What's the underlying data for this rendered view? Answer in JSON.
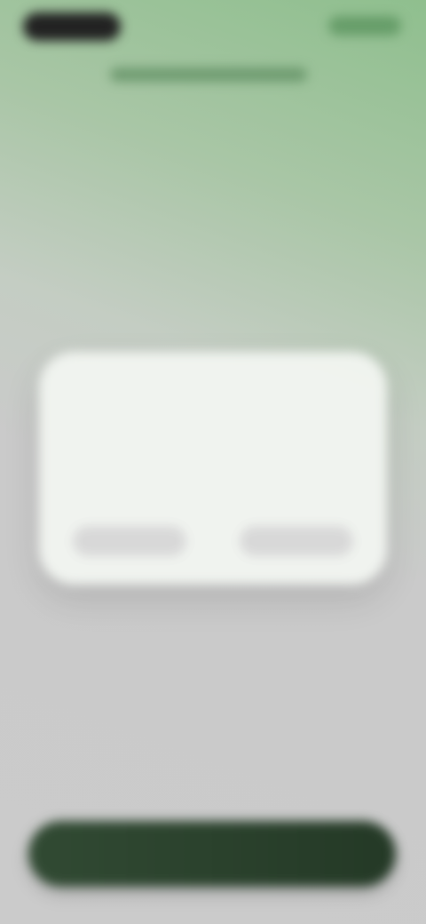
{
  "ui": {
    "status_left": "",
    "status_right": "",
    "title": "",
    "headline_line_1": "",
    "headline_line_2": "",
    "subtext_lines": [
      "",
      "",
      ""
    ],
    "card": {
      "title": "",
      "body": "",
      "left_button": "",
      "right_button": ""
    },
    "cta": ""
  }
}
